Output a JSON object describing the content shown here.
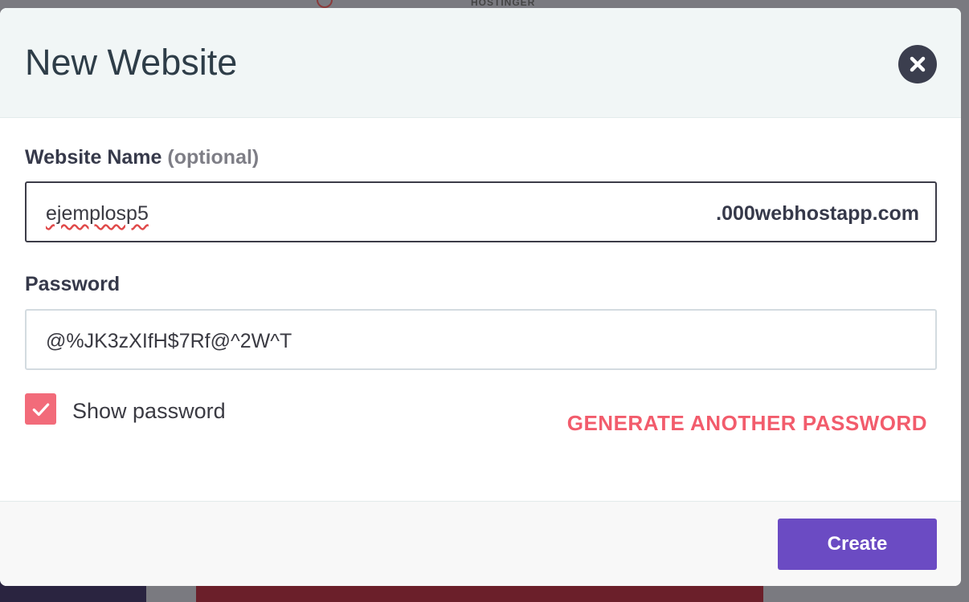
{
  "background": {
    "logo_text": "HOSTINGER"
  },
  "modal": {
    "title": "New Website",
    "website_name": {
      "label": "Website Name",
      "optional": "(optional)",
      "value": "ejemplosp5",
      "suffix": ".000webhostapp.com"
    },
    "password": {
      "label": "Password",
      "value": "@%JK3zXIfH$7Rf@^2W^T"
    },
    "show_password": {
      "label": "Show password",
      "checked": true
    },
    "generate_link": "GENERATE ANOTHER PASSWORD",
    "create_button": "Create"
  },
  "colors": {
    "accent_purple": "#6b4bc3",
    "accent_pink": "#f25c6c",
    "header_bg": "#f1f6f6"
  },
  "icons": {
    "close": "close-icon",
    "check": "checkmark-icon"
  }
}
